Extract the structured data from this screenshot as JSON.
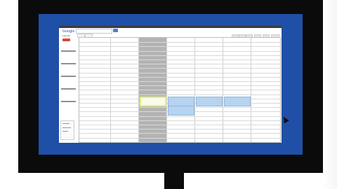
{
  "app": {
    "logo_text": "Google",
    "header_title": "Calendar",
    "create_label": "",
    "sidebar_box_label": ""
  },
  "calendar": {
    "days": [
      "",
      "",
      "",
      "",
      "",
      "",
      ""
    ],
    "events": [
      {
        "day": 2,
        "row": 12,
        "title": "",
        "selected": true
      },
      {
        "day": 3,
        "row": 12,
        "title": "",
        "selected": false
      },
      {
        "day": 4,
        "row": 12,
        "title": "",
        "selected": false
      },
      {
        "day": 5,
        "row": 12,
        "title": "",
        "selected": false
      },
      {
        "day": 3,
        "row": 14,
        "title": "",
        "selected": false
      }
    ]
  },
  "colors": {
    "screen_frame": "#1f4fa6",
    "event_fill": "#b6d3ef",
    "selected_outline": "#e6f27a",
    "create_button": "#d44a3a"
  }
}
